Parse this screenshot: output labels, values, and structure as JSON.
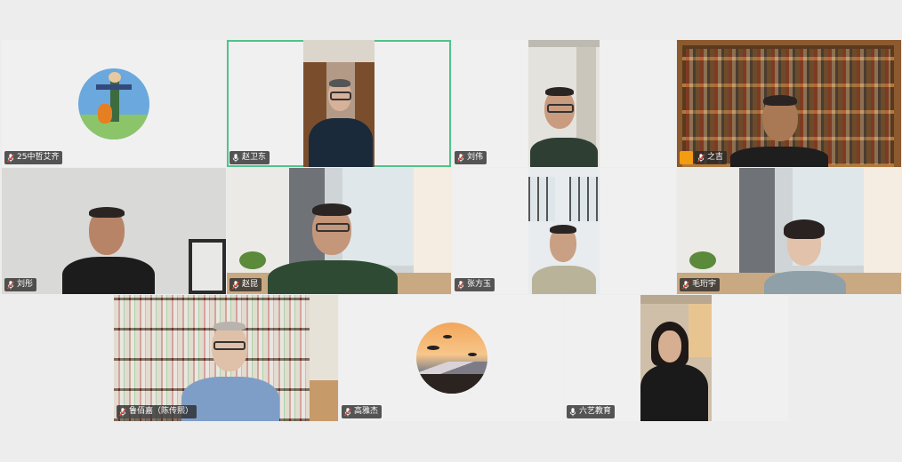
{
  "participants": [
    {
      "name": "25中哲艾齐",
      "mic": "muted"
    },
    {
      "name": "赵卫东",
      "mic": "on",
      "active": true
    },
    {
      "name": "刘伟",
      "mic": "muted"
    },
    {
      "name": "之吉",
      "mic": "muted",
      "host": true
    },
    {
      "name": "刘彤",
      "mic": "muted"
    },
    {
      "name": "赵昆",
      "mic": "muted"
    },
    {
      "name": "张方玉",
      "mic": "muted"
    },
    {
      "name": "毛珩宇",
      "mic": "muted"
    },
    {
      "name": "鲁佰嘉（陈传熙）",
      "mic": "muted"
    },
    {
      "name": "高雅杰",
      "mic": "muted"
    },
    {
      "name": "六艺教育",
      "mic": "on"
    }
  ],
  "colors": {
    "active_border": "#4fc48a",
    "host_badge": "#f39c12",
    "muted_mic": "#e74c3c"
  }
}
